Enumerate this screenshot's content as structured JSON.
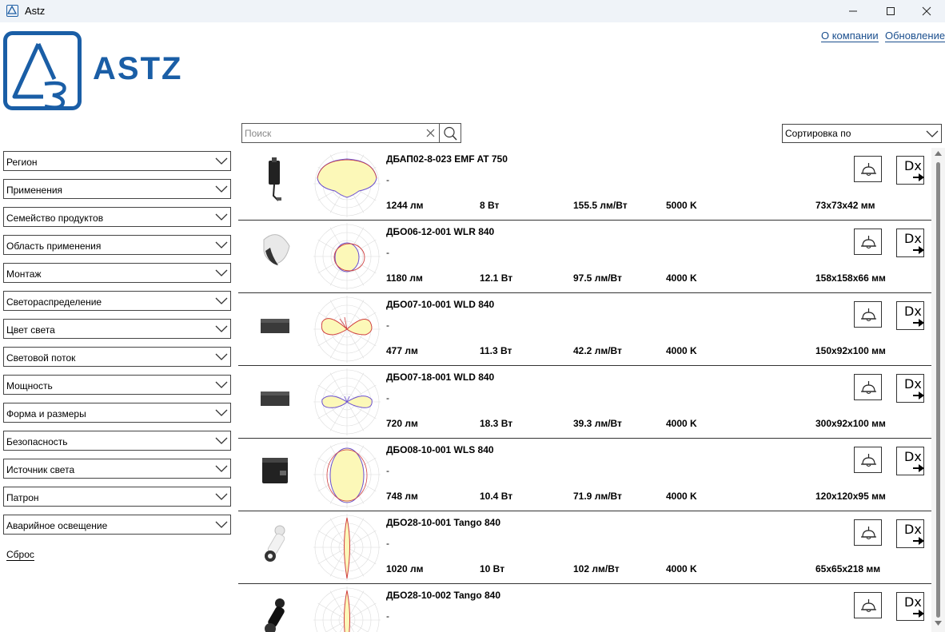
{
  "window": {
    "title": "Astz"
  },
  "brand": {
    "logo_text": "ASTZ",
    "color": "#1a5ea6"
  },
  "top_links": {
    "about": "О компании",
    "update": "Обновление"
  },
  "search": {
    "placeholder": "Поиск",
    "value": ""
  },
  "sort": {
    "label": "Сортировка по"
  },
  "filters": [
    "Регион",
    "Применения",
    "Семейство продуктов",
    "Область применения",
    "Монтаж",
    "Светораспределение",
    "Цвет света",
    "Световой поток",
    "Мощность",
    "Форма и размеры",
    "Безопасность",
    "Источник света",
    "Патрон",
    "Аварийное освещение"
  ],
  "reset_label": "Сброс",
  "products": [
    {
      "name": "ДБАП02-8-023 EMF AT 750",
      "desc": "-",
      "flux": "1244 лм",
      "power": "8 Вт",
      "efficacy": "155.5 лм/Вт",
      "cct": "5000 K",
      "size": "73x73x42 мм"
    },
    {
      "name": "ДБО06-12-001 WLR 840",
      "desc": "-",
      "flux": "1180 лм",
      "power": "12.1 Вт",
      "efficacy": "97.5 лм/Вт",
      "cct": "4000 K",
      "size": "158x158x66 мм"
    },
    {
      "name": "ДБО07-10-001 WLD 840",
      "desc": "-",
      "flux": "477 лм",
      "power": "11.3 Вт",
      "efficacy": "42.2 лм/Вт",
      "cct": "4000 K",
      "size": "150x92x100 мм"
    },
    {
      "name": "ДБО07-18-001 WLD 840",
      "desc": "-",
      "flux": "720 лм",
      "power": "18.3 Вт",
      "efficacy": "39.3 лм/Вт",
      "cct": "4000 K",
      "size": "300x92x100 мм"
    },
    {
      "name": "ДБО08-10-001 WLS 840",
      "desc": "-",
      "flux": "748 лм",
      "power": "10.4 Вт",
      "efficacy": "71.9 лм/Вт",
      "cct": "4000 K",
      "size": "120x120x95 мм"
    },
    {
      "name": "ДБО28-10-001 Tango 840",
      "desc": "-",
      "flux": "1020 лм",
      "power": "10 Вт",
      "efficacy": "102 лм/Вт",
      "cct": "4000 K",
      "size": "65x65x218 мм"
    },
    {
      "name": "ДБО28-10-002 Tango 840",
      "desc": "-",
      "flux": "",
      "power": "",
      "efficacy": "",
      "cct": "",
      "size": ""
    }
  ],
  "dx_label": "Dx",
  "icons": {
    "app": "astz-logo-icon",
    "minimize": "minimize-icon",
    "maximize": "maximize-icon",
    "close": "close-icon",
    "search": "magnifier-icon",
    "clear": "x-icon",
    "chevron": "chevron-down-icon",
    "lamp": "pendant-lamp-icon",
    "export": "arrow-right-icon"
  }
}
